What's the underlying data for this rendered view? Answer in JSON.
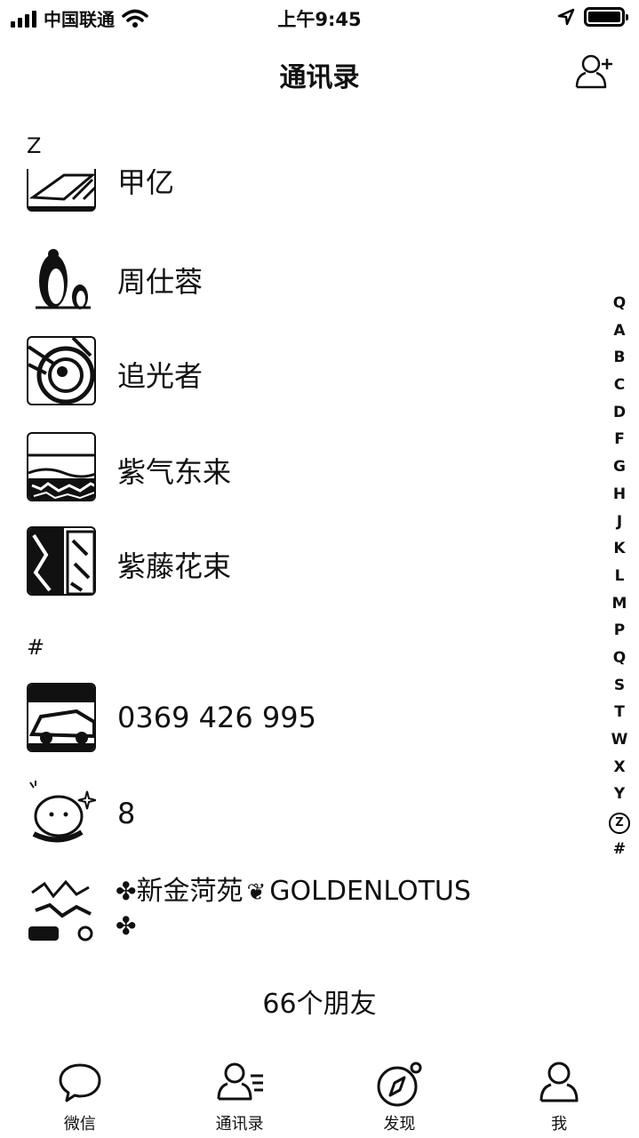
{
  "status_bar": {
    "carrier": "中国联通",
    "time": "上午9:45"
  },
  "nav": {
    "title": "通讯录"
  },
  "sections": {
    "z": {
      "letter": "Z"
    },
    "hash": {
      "letter": "#"
    }
  },
  "contacts": [
    {
      "name": "甲亿"
    },
    {
      "name": "周仕蓉"
    },
    {
      "name": "追光者"
    },
    {
      "name": "紫气东来"
    },
    {
      "name": "紫藤花束"
    },
    {
      "name": "0369 426 995"
    },
    {
      "name": "8"
    },
    {
      "name_line1": "新金菏苑",
      "name_line1_b": "GOLDENLOTUS"
    }
  ],
  "index_letters": [
    "Q",
    "A",
    "B",
    "C",
    "D",
    "F",
    "G",
    "H",
    "J",
    "K",
    "L",
    "M",
    "P",
    "Q",
    "S",
    "T",
    "W",
    "X",
    "Y",
    "Z",
    "#"
  ],
  "index_active": "Z",
  "footer": {
    "friend_count": "66个朋友"
  },
  "tabs": [
    {
      "label": "微信",
      "icon": "chat-bubble-icon"
    },
    {
      "label": "通讯录",
      "icon": "contacts-icon"
    },
    {
      "label": "发现",
      "icon": "compass-icon"
    },
    {
      "label": "我",
      "icon": "person-icon"
    }
  ]
}
